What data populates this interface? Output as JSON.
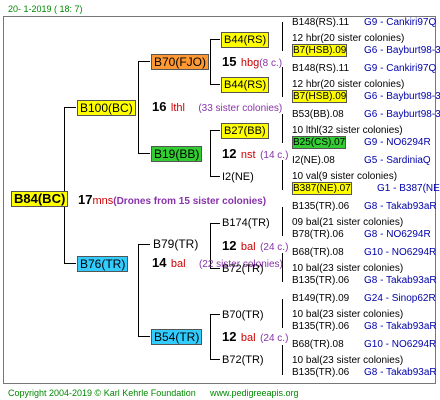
{
  "header": {
    "date": "20-   1-2019  (  18:   7)"
  },
  "footer": {
    "copyright": "Copyright 2004-2019 © Karl Kehrle Foundation",
    "site": "www.pedigreeapis.org"
  },
  "root": {
    "name": "B84(BC)",
    "gen_num": "17",
    "mark": "mns",
    "note": "(Drones from 15 sister colonies)"
  },
  "mother": {
    "name": "B100(BC)",
    "gen_num": "16",
    "mark": "lthl",
    "col": "(33 sister colonies)"
  },
  "father": {
    "name": "B76(TR)",
    "gen_num": "14",
    "mark": "bal",
    "col": "(22 sister colonies)"
  },
  "mm": {
    "name": "B70(FJO)",
    "gen_num": "15",
    "mark": "hbg",
    "col": "(8 c.)"
  },
  "mf": {
    "name": "B19(BB)",
    "gen_num": "12",
    "mark": "nst",
    "col": "(14 c.)"
  },
  "fm": {
    "name": "B79(TR)",
    "gen_num": "12",
    "mark": "bal",
    "col": "(24 c.)"
  },
  "ff": {
    "name": "B54(TR)",
    "gen_num": "12",
    "mark": "bal",
    "col": "(24 c.)"
  },
  "g3": [
    {
      "name": "B44(RS)"
    },
    {
      "name": "B44(RS)"
    },
    {
      "name": "B27(BB)"
    },
    {
      "name": "I2(NE)"
    },
    {
      "name": "B174(TR)"
    },
    {
      "name": "B72(TR)"
    },
    {
      "name": "B70(TR)"
    },
    {
      "name": "B72(TR)"
    }
  ],
  "leaves": [
    {
      "t": "B148(RS).11",
      "info": "G9 - Cankiri97Q"
    },
    {
      "t": "12 hbr(20 sister colonies)"
    },
    {
      "t": "B7(HSB).09",
      "info": "G6 - Bayburt98-3"
    },
    {
      "t": "B148(RS).11",
      "info": "G9 - Cankiri97Q"
    },
    {
      "t": "12 hbr(20 sister colonies)"
    },
    {
      "t": "B7(HSB).09",
      "info": "G6 - Bayburt98-3"
    },
    {
      "t": "B53(BB).08",
      "info": "G6 - Bayburt98-3"
    },
    {
      "t": "10 lthl(32 sister colonies)"
    },
    {
      "t": "B25(CS).07",
      "info": "G9 - NO6294R"
    },
    {
      "t": "I2(NE).08",
      "info": "G5 - SardiniaQ"
    },
    {
      "t": "10 val(9 sister colonies)"
    },
    {
      "t": "B387(NE).07",
      "info": "G1 - B387(NE)"
    },
    {
      "t": "B135(TR).06",
      "info": "G8 - Takab93aR"
    },
    {
      "t": "09 bal(21 sister colonies)"
    },
    {
      "t": "B78(TR).06",
      "info": "G8 - NO6294R"
    },
    {
      "t": "B68(TR).08",
      "info": "G10 - NO6294R"
    },
    {
      "t": "10 bal(23 sister colonies)"
    },
    {
      "t": "B135(TR).06",
      "info": "G8 - Takab93aR"
    },
    {
      "t": "B149(TR).09",
      "info": "G24 - Sinop62R"
    },
    {
      "t": "10 bal(23 sister colonies)"
    },
    {
      "t": "B135(TR).06",
      "info": "G8 - Takab93aR"
    },
    {
      "t": "B68(TR).08",
      "info": "G10 - NO6294R"
    },
    {
      "t": "10 bal(23 sister colonies)"
    },
    {
      "t": "B135(TR).06",
      "info": "G8 - Takab93aR"
    }
  ]
}
